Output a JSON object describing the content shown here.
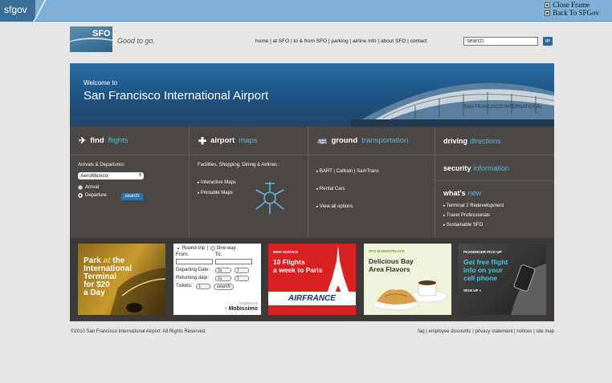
{
  "frame": {
    "tab_label": "sfgov",
    "close_frame": "Close Frame",
    "back_to": "Back To SFGov"
  },
  "header": {
    "logo_text": "SFO",
    "tagline": "Good to go.",
    "nav": [
      "home",
      "at SFO",
      "to & from SFO",
      "parking",
      "airline info",
      "about SFO",
      "contact"
    ],
    "search_placeholder": "search",
    "go_label": "go"
  },
  "hero": {
    "welcome": "Welcome to",
    "title": "San Francisco International Airport",
    "building_sign": "SAN FRANCISCO INTERNATIONAL"
  },
  "find_flights": {
    "title_a": "find",
    "title_b": "flights",
    "arrivals_label": "Arrivals & Departures:",
    "airline_selected": "AeroMexico",
    "radio_arrival": "Arrival",
    "radio_departure": "Departure",
    "search_label": "search"
  },
  "airport_maps": {
    "title_a": "airport",
    "title_b": "maps",
    "subtitle": "Facilities, Shopping, Dining & Airlines :",
    "links": [
      "Interactive Maps",
      "Printable Maps"
    ]
  },
  "ground": {
    "title_a": "ground",
    "title_b": "transportation",
    "links": [
      "BART  |  Caltrain  |  SamTrans",
      "Rental Cars",
      "View all options"
    ]
  },
  "right_col": {
    "driving_a": "driving",
    "driving_b": "directions",
    "security_a": "security",
    "security_b": "information",
    "whats_a": "what's",
    "whats_b": "new",
    "whats_links": [
      "Terminal 2 Redevelopment",
      "Travel Professionals",
      "Sustainable SFO"
    ]
  },
  "banners": {
    "park": {
      "l1": "Park ",
      "l1b": "at",
      "l1c": " the",
      "l2": "International",
      "l3": "Terminal",
      "l4": "for $20",
      "l5": "a Day"
    },
    "booking": {
      "roundtrip": "Round-trip",
      "oneway": "One-way",
      "from": "From:",
      "to": "To:",
      "departing": "Departing Date:",
      "returning": "Returning date:",
      "tickets": "Tickets:",
      "month": "Ju",
      "day": "1",
      "tickets_val": "1",
      "search": "search",
      "powered": "POWERED BY",
      "brand": "Mobissimo"
    },
    "airfrance": {
      "tag": "NEW SERVICE",
      "l1": "10 Flights",
      "l2": "a week to Paris",
      "brand": "AIRFRANCE"
    },
    "marketplace": {
      "tag": "SFO MARKETPLACE",
      "l1": "Delicious Bay",
      "l2": "Area Flavors"
    },
    "pickup": {
      "tag": "PASSENGER PICK-UP",
      "l1": "Get free flight",
      "l2": "info on your",
      "l3": "cell phone",
      "cta": "SIGN UP »"
    }
  },
  "footer": {
    "copyright": "©2010 San Francisco International Airport. All Rights Reserved.",
    "links": [
      "faq",
      "employee discounts",
      "privacy statement",
      "notices",
      "site map"
    ]
  },
  "colors": {
    "accent": "#5fb4dc",
    "hero": "#1d5283",
    "panel": "#4a4745"
  }
}
